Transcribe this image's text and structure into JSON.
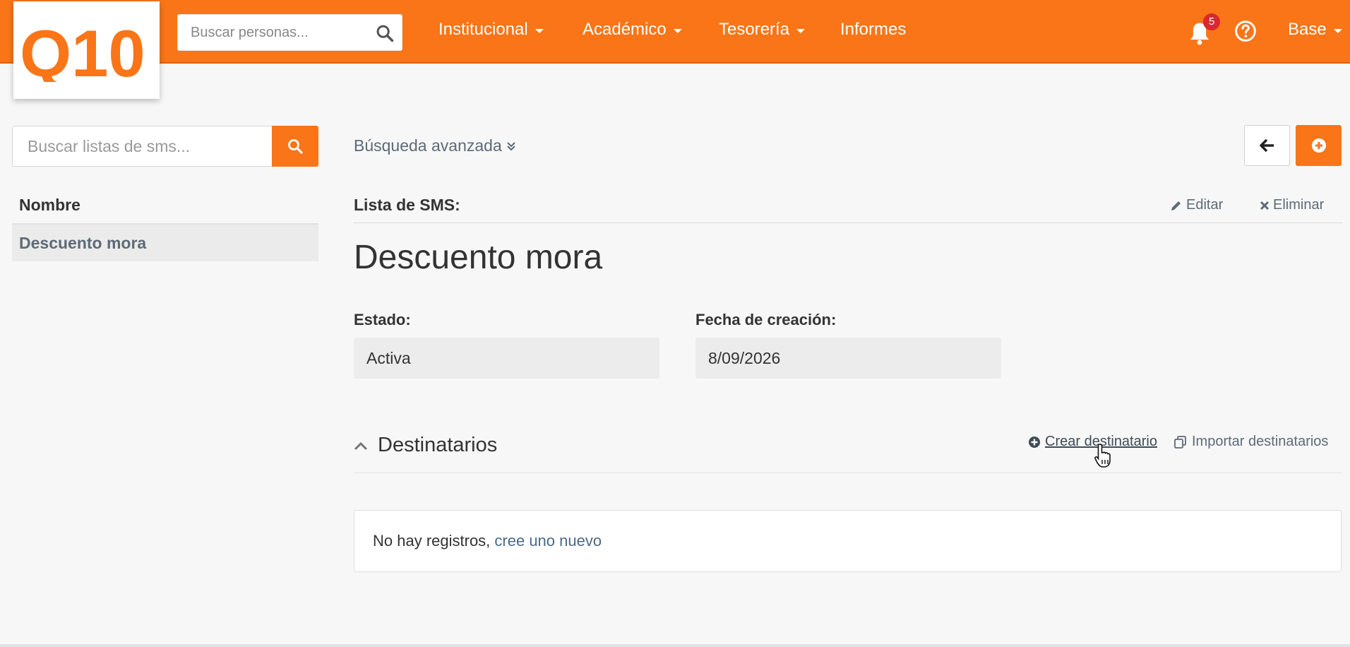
{
  "brand": {
    "logo_text": "Q10",
    "accent": "#f97517"
  },
  "topnav": {
    "search_placeholder": "Buscar personas...",
    "items": [
      {
        "label": "Institucional",
        "dropdown": true
      },
      {
        "label": "Académico",
        "dropdown": true
      },
      {
        "label": "Tesorería",
        "dropdown": true
      },
      {
        "label": "Informes",
        "dropdown": false
      }
    ],
    "notifications_count": "5",
    "user_menu_label": "Base",
    "icons": [
      "search-icon",
      "bell-icon",
      "help-icon"
    ]
  },
  "sidebar": {
    "search_placeholder": "Buscar listas de sms...",
    "column_header": "Nombre",
    "rows": [
      {
        "label": "Descuento mora"
      }
    ]
  },
  "toolbar": {
    "advanced_search_label": "Búsqueda avanzada",
    "icons": [
      "arrow-left-icon",
      "plus-circle-icon"
    ]
  },
  "detail": {
    "section_label": "Lista de SMS:",
    "edit_label": "Editar",
    "delete_label": "Eliminar",
    "title": "Descuento mora",
    "fields": [
      {
        "label": "Estado:",
        "value": "Activa"
      },
      {
        "label": "Fecha de creación:",
        "value": "8/09/2026"
      }
    ]
  },
  "recipients": {
    "heading": "Destinatarios",
    "create_label": "Crear destinatario",
    "import_label": "Importar destinatarios",
    "empty_text": "No hay registros, ",
    "empty_link": "cree uno nuevo"
  }
}
